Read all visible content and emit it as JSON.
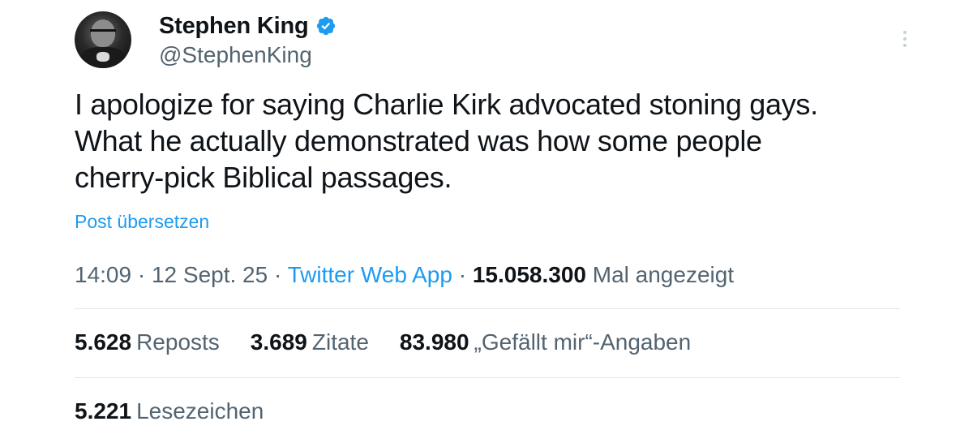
{
  "author": {
    "display_name": "Stephen King",
    "handle": "@StephenKing",
    "verified": true,
    "avatar_icon": "profile-photo"
  },
  "tweet": {
    "lines": [
      "I apologize for saying Charlie Kirk advocated stoning gays.",
      "What he actually demonstrated was how some people",
      "cherry-pick Biblical passages."
    ],
    "translate_label": "Post übersetzen"
  },
  "meta": {
    "time": "14:09",
    "separator": "·",
    "date": "12 Sept. 25",
    "app": "Twitter Web App",
    "views_count": "15.058.300",
    "views_label": "Mal angezeigt"
  },
  "stats": {
    "reposts_count": "5.628",
    "reposts_label": "Reposts",
    "quotes_count": "3.689",
    "quotes_label": "Zitate",
    "likes_count": "83.980",
    "likes_label": "„Gefällt mir“-Angaben",
    "bookmarks_count": "5.221",
    "bookmarks_label": "Lesezeichen"
  },
  "colors": {
    "accent": "#1d9bf0",
    "text_primary": "#0f1419",
    "text_secondary": "#536471",
    "divider": "#e1e6ea"
  },
  "icons": {
    "verified": "verified-badge-icon",
    "more": "more-vertical-icon"
  }
}
